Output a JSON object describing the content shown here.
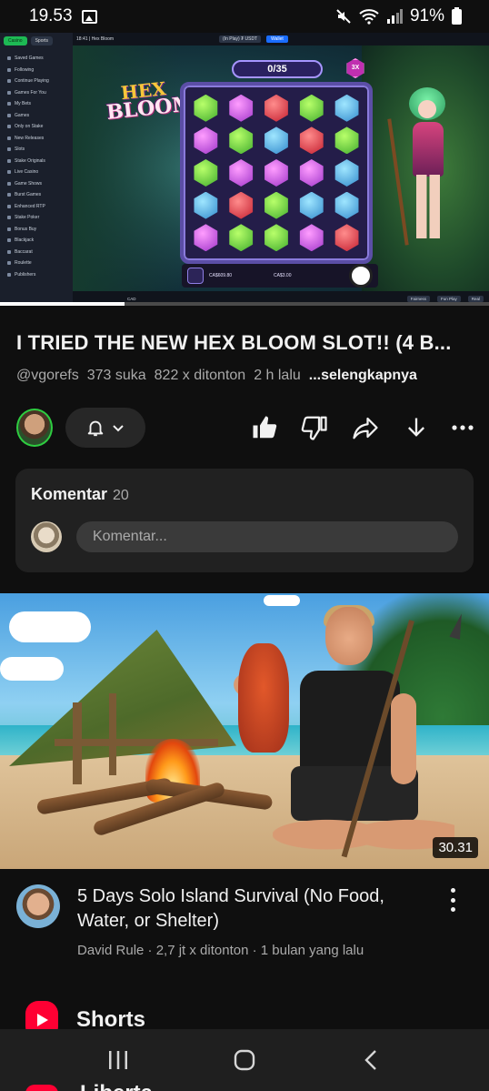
{
  "status_bar": {
    "time": "19.53",
    "battery": "91%",
    "icons": [
      "gallery-icon",
      "mute-icon",
      "wifi-icon",
      "signal-icon",
      "battery-icon"
    ]
  },
  "player": {
    "sidebar_tabs": [
      "Casino",
      "Sports"
    ],
    "sidebar_items": [
      "Saved Games",
      "Following",
      "Continue Playing",
      "Games For You",
      "My Bets",
      "Games",
      "Only on Stake",
      "New Releases",
      "Slots",
      "Stake Originals",
      "Live Casino",
      "Game Shows",
      "Burst Games",
      "Enhanced RTP",
      "Stake Poker",
      "Bonus Buy",
      "Blackjack",
      "Baccarat",
      "Roulette",
      "Publishers"
    ],
    "topbar_title": "18:41 | Hex Bloom",
    "wallet_label": "(In Play) ₮ USDT",
    "wallet_button": "Wallet",
    "game_logo_line1": "HEX",
    "game_logo_line2": "BLOOM",
    "counter": "0/35",
    "multiplier_badge": "3X",
    "balance": "CA$609.80",
    "bet": "CA$3.00",
    "currency": "CAD",
    "bottom_buttons": [
      "Fairness",
      "Fun Play",
      "Real"
    ],
    "progress_fraction": 0.255
  },
  "video": {
    "title": "I TRIED THE NEW HEX BLOOM SLOT!! (4 B...",
    "channel": "@vgorefs",
    "likes": "373 suka",
    "views": "822 x ditonton",
    "age": "2 h lalu",
    "more": "...selengkapnya"
  },
  "actions": {
    "icons": [
      "bell-icon",
      "chevron-down-icon",
      "like-icon",
      "dislike-icon",
      "share-icon",
      "download-icon",
      "more-icon"
    ]
  },
  "comments": {
    "header": "Komentar",
    "count": "20",
    "placeholder": "Komentar..."
  },
  "next_video": {
    "title": "5 Days Solo Island Survival (No Food, Water, or Shelter)",
    "meta": "David Rule · 2,7 jt x ditonton · 1 bulan yang lalu",
    "duration": "30.31"
  },
  "shorts": {
    "label": "Shorts",
    "next_label": "Liberta"
  },
  "navbar": {
    "icons": [
      "recent-apps-icon",
      "home-icon",
      "back-icon"
    ]
  },
  "colors": {
    "background": "#0f0f0f",
    "card": "#212121",
    "accent_red": "#ff0033",
    "secondary_text": "#aaaaaa"
  }
}
